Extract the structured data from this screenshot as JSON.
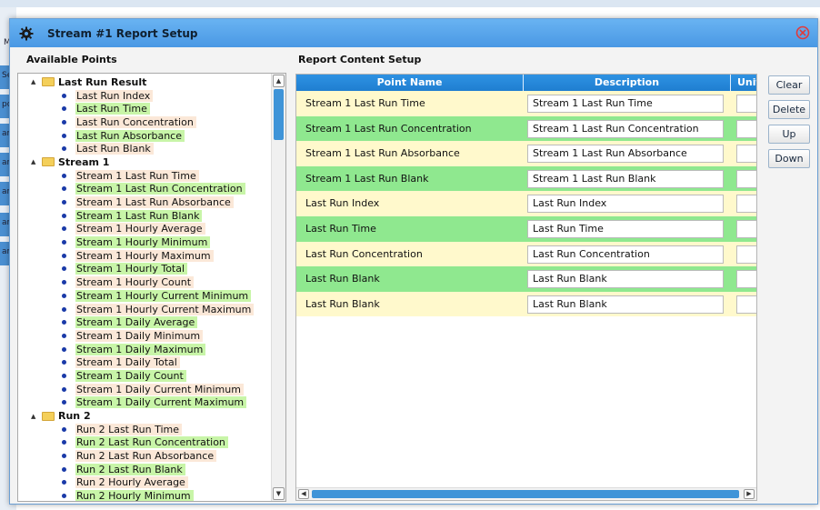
{
  "background": {
    "tabs": [
      "M",
      "Set",
      "po",
      "am",
      "am",
      "am",
      "am",
      "am"
    ]
  },
  "dialog": {
    "title": "Stream #1 Report Setup",
    "icon": "gear-icon",
    "close_icon": "close-circle-icon",
    "colors": {
      "title_bar": "#4a98e4",
      "close": "#e23a3a",
      "header": "#1f7ed0",
      "row_yellow": "#fff9cc",
      "row_green": "#8fe88f",
      "highlight_green": "#c8f5a8",
      "highlight_peach": "#fbe8d8"
    }
  },
  "available_points": {
    "label": "Available Points",
    "groups": [
      {
        "label": "Last Run Result",
        "expander": "▲",
        "items": [
          {
            "label": "Last Run Index",
            "hl": "peach"
          },
          {
            "label": "Last Run Time",
            "hl": "green"
          },
          {
            "label": "Last Run Concentration",
            "hl": "peach"
          },
          {
            "label": "Last Run Absorbance",
            "hl": "green"
          },
          {
            "label": "Last Run Blank",
            "hl": "peach"
          }
        ]
      },
      {
        "label": "Stream 1",
        "expander": "▲",
        "items": [
          {
            "label": "Stream 1 Last Run Time",
            "hl": "peach"
          },
          {
            "label": "Stream 1 Last Run Concentration",
            "hl": "green"
          },
          {
            "label": "Stream 1 Last Run Absorbance",
            "hl": "peach"
          },
          {
            "label": "Stream 1 Last Run Blank",
            "hl": "green"
          },
          {
            "label": "Stream 1 Hourly Average",
            "hl": "peach"
          },
          {
            "label": "Stream 1 Hourly Minimum",
            "hl": "green"
          },
          {
            "label": "Stream 1 Hourly Maximum",
            "hl": "peach"
          },
          {
            "label": "Stream 1 Hourly Total",
            "hl": "green"
          },
          {
            "label": "Stream 1 Hourly Count",
            "hl": "peach"
          },
          {
            "label": "Stream 1 Hourly Current Minimum",
            "hl": "green"
          },
          {
            "label": "Stream 1 Hourly Current Maximum",
            "hl": "peach"
          },
          {
            "label": "Stream 1 Daily Average",
            "hl": "green"
          },
          {
            "label": "Stream 1 Daily Minimum",
            "hl": "peach"
          },
          {
            "label": "Stream 1 Daily Maximum",
            "hl": "green"
          },
          {
            "label": "Stream 1 Daily Total",
            "hl": "peach"
          },
          {
            "label": "Stream 1 Daily Count",
            "hl": "green"
          },
          {
            "label": "Stream 1 Daily Current Minimum",
            "hl": "peach"
          },
          {
            "label": "Stream 1 Daily Current Maximum",
            "hl": "green"
          }
        ]
      },
      {
        "label": "Run 2",
        "expander": "▲",
        "items": [
          {
            "label": "Run 2 Last Run Time",
            "hl": "peach"
          },
          {
            "label": "Run 2 Last Run Concentration",
            "hl": "green"
          },
          {
            "label": "Run 2 Last Run Absorbance",
            "hl": "peach"
          },
          {
            "label": "Run 2 Last Run Blank",
            "hl": "green"
          },
          {
            "label": "Run 2 Hourly Average",
            "hl": "peach"
          },
          {
            "label": "Run 2 Hourly Minimum",
            "hl": "green"
          }
        ]
      }
    ]
  },
  "report_content": {
    "label": "Report Content Setup",
    "columns": [
      "Point Name",
      "Description",
      "Unit"
    ],
    "rows": [
      {
        "point": "Stream 1 Last Run Time",
        "description": "Stream 1 Last Run Time",
        "unit": "",
        "style": "yellow"
      },
      {
        "point": "Stream 1 Last Run Concentration",
        "description": "Stream 1 Last Run Concentration",
        "unit": "",
        "style": "green"
      },
      {
        "point": "Stream 1 Last Run Absorbance",
        "description": "Stream 1 Last Run Absorbance",
        "unit": "",
        "style": "yellow"
      },
      {
        "point": "Stream 1 Last Run Blank",
        "description": "Stream 1 Last Run Blank",
        "unit": "",
        "style": "green"
      },
      {
        "point": "Last Run Index",
        "description": "Last Run Index",
        "unit": "",
        "style": "yellow"
      },
      {
        "point": "Last Run Time",
        "description": "Last Run Time",
        "unit": "",
        "style": "green"
      },
      {
        "point": "Last Run Concentration",
        "description": "Last Run Concentration",
        "unit": "",
        "style": "yellow"
      },
      {
        "point": "Last Run Blank",
        "description": "Last Run Blank",
        "unit": "",
        "style": "green"
      },
      {
        "point": "Last Run Blank",
        "description": "Last Run Blank",
        "unit": "",
        "style": "yellow"
      }
    ]
  },
  "actions": {
    "clear": "Clear",
    "delete": "Delete",
    "up": "Up",
    "down": "Down"
  }
}
